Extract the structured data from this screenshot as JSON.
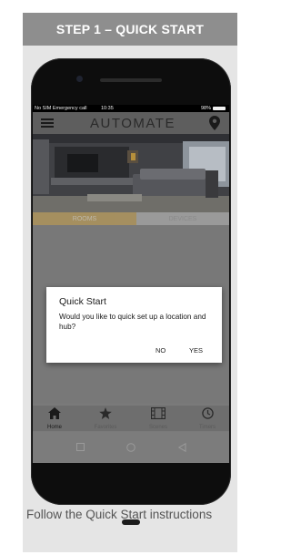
{
  "step_header": "STEP 1 – QUICK START",
  "phone": {
    "status_bar": {
      "left": "No SIM  Emergency call",
      "time": "10:35",
      "battery": "98%"
    },
    "app_bar": {
      "logo_text": "AUTOMATE"
    },
    "tabs": [
      "ROOMS",
      "DEVICES"
    ],
    "dialog": {
      "title": "Quick Start",
      "message": "Would you like to quick set up a location and hub?",
      "no_label": "NO",
      "yes_label": "YES"
    },
    "bottom_nav": [
      {
        "label": "Home",
        "icon": "home-icon"
      },
      {
        "label": "Favorites",
        "icon": "star-icon"
      },
      {
        "label": "Scenes",
        "icon": "film-icon"
      },
      {
        "label": "Timers",
        "icon": "clock-icon"
      }
    ],
    "system_nav": [
      "square-icon",
      "circle-icon",
      "triangle-back-icon"
    ]
  },
  "caption": "Follow the Quick Start instructions",
  "colors": {
    "header_bg": "#8e8e8e",
    "card_bg": "#e5e5e5",
    "tab_active": "#c9a14a",
    "screen_dim": "#787878"
  }
}
